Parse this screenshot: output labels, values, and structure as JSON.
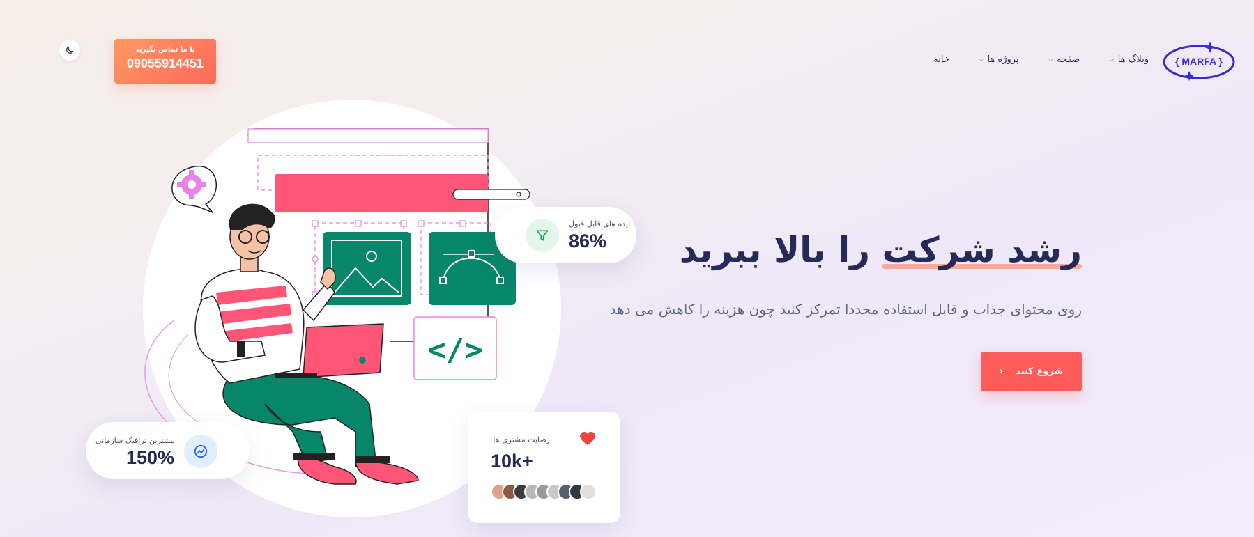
{
  "header": {
    "logo_text": "{ MARFA }",
    "nav": [
      {
        "label": "خانه",
        "has_dropdown": false
      },
      {
        "label": "پروژه ها",
        "has_dropdown": true
      },
      {
        "label": "صفحه",
        "has_dropdown": true
      },
      {
        "label": "وبلاگ ها",
        "has_dropdown": true
      }
    ],
    "contact": {
      "label": "با ما تماس بگیرید",
      "phone": "09055914451"
    },
    "theme_icon": "moon-icon"
  },
  "hero": {
    "title_highlight": "رشد شرکت",
    "title_rest": " را بالا ببرید",
    "subtitle": "روی محتوای جذاب و قابل استفاده مجددا تمرکز کنید چون هزینه را کاهش می دهد",
    "cta_label": "شروع کنید"
  },
  "stats": {
    "ideas": {
      "label": "ایده های قابل قبول",
      "value": "86%",
      "icon": "filter-icon"
    },
    "traffic": {
      "label": "بیشترین ترافیک سازمانی",
      "value": "150%",
      "icon": "trend-icon"
    },
    "satisfaction": {
      "label": "رضایت مشتری ها",
      "value": "10k+",
      "icon": "heart-icon"
    }
  },
  "colors": {
    "accent": "#ff5b5b",
    "brand": "#3a2ad4",
    "green": "#078669",
    "pink": "#ff5577"
  }
}
